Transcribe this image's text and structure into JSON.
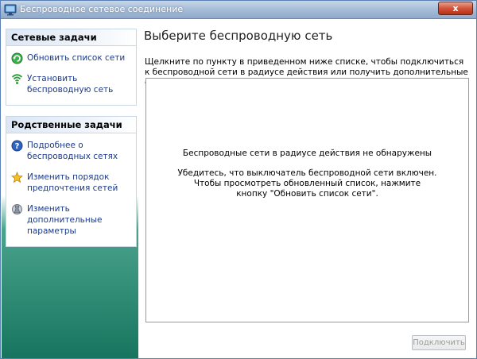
{
  "window": {
    "title": "Беспроводное сетевое соединение",
    "close_label": "x"
  },
  "left": {
    "network_tasks": {
      "header": "Сетевые задачи",
      "items": [
        {
          "label": "Обновить список сети",
          "icon": "refresh-icon"
        },
        {
          "label": "Установить беспроводную сеть",
          "icon": "wireless-setup-icon"
        }
      ]
    },
    "related_tasks": {
      "header": "Родственные задачи",
      "items": [
        {
          "label": "Подробнее о беспроводных сетях",
          "icon": "help-icon"
        },
        {
          "label": "Изменить порядок предпочтения сетей",
          "icon": "star-icon"
        },
        {
          "label": "Изменить дополнительные параметры",
          "icon": "settings-icon"
        }
      ]
    }
  },
  "main": {
    "heading": "Выберите беспроводную сеть",
    "instructions": "Щелкните по пункту в приведенном ниже списке, чтобы подключиться к беспроводной сети в радиусе действия или получить дополнительные сведения.",
    "list_message_1": "Беспроводные сети в радиусе действия не обнаружены",
    "list_message_2": "Убедитесь, что выключатель беспроводной сети включен.",
    "list_message_3": "Чтобы просмотреть обновленный список, нажмите кнопку \"Обновить список сети\".",
    "connect_button": "Подключить"
  }
}
